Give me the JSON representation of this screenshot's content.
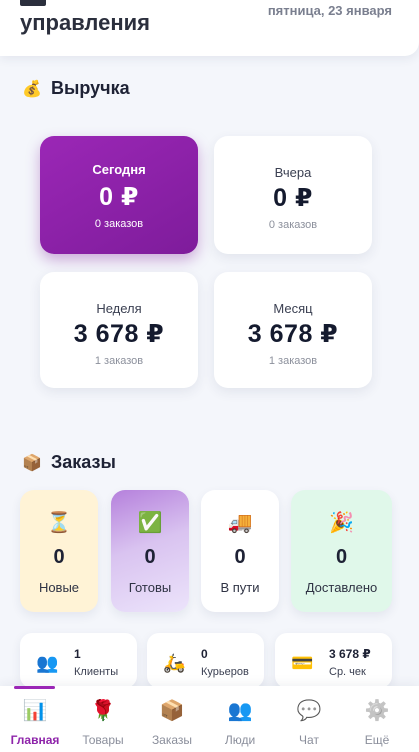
{
  "header": {
    "title": "управления",
    "date": "пятница, 23 января"
  },
  "revenue": {
    "title": "Выручка",
    "icon": "money-bag-icon",
    "cards": [
      {
        "label": "Сегодня",
        "value": "0 ₽",
        "sub": "0 заказов"
      },
      {
        "label": "Вчера",
        "value": "0 ₽",
        "sub": "0 заказов"
      },
      {
        "label": "Неделя",
        "value": "3 678 ₽",
        "sub": "1 заказов"
      },
      {
        "label": "Месяц",
        "value": "3 678 ₽",
        "sub": "1 заказов"
      }
    ],
    "active_color": "#9b27b6"
  },
  "orders": {
    "title": "Заказы",
    "icon": "package-icon",
    "statuses": [
      {
        "label": "Новые",
        "count": "0",
        "icon": "hourglass-icon",
        "color": "#fff3d6"
      },
      {
        "label": "Готовы",
        "count": "0",
        "icon": "check-icon",
        "color": "#d9c3f0"
      },
      {
        "label": "В пути",
        "count": "0",
        "icon": "truck-icon",
        "color": "#ffffff"
      },
      {
        "label": "Доставлено",
        "count": "0",
        "icon": "party-popper-icon",
        "color": "#e0f8ea"
      }
    ]
  },
  "stats": [
    {
      "value": "1",
      "label": "Клиенты",
      "icon": "people-icon"
    },
    {
      "value": "0",
      "label": "Курьеров",
      "icon": "scooter-icon"
    },
    {
      "value": "3 678 ₽",
      "label": "Ср. чек",
      "icon": "credit-card-icon"
    }
  ],
  "nav": [
    {
      "label": "Главная",
      "icon": "chart-icon",
      "active": true
    },
    {
      "label": "Товары",
      "icon": "rose-icon"
    },
    {
      "label": "Заказы",
      "icon": "package-icon"
    },
    {
      "label": "Люди",
      "icon": "people-icon"
    },
    {
      "label": "Чат",
      "icon": "chat-bubble-icon"
    },
    {
      "label": "Ещё",
      "icon": "gear-icon"
    }
  ]
}
